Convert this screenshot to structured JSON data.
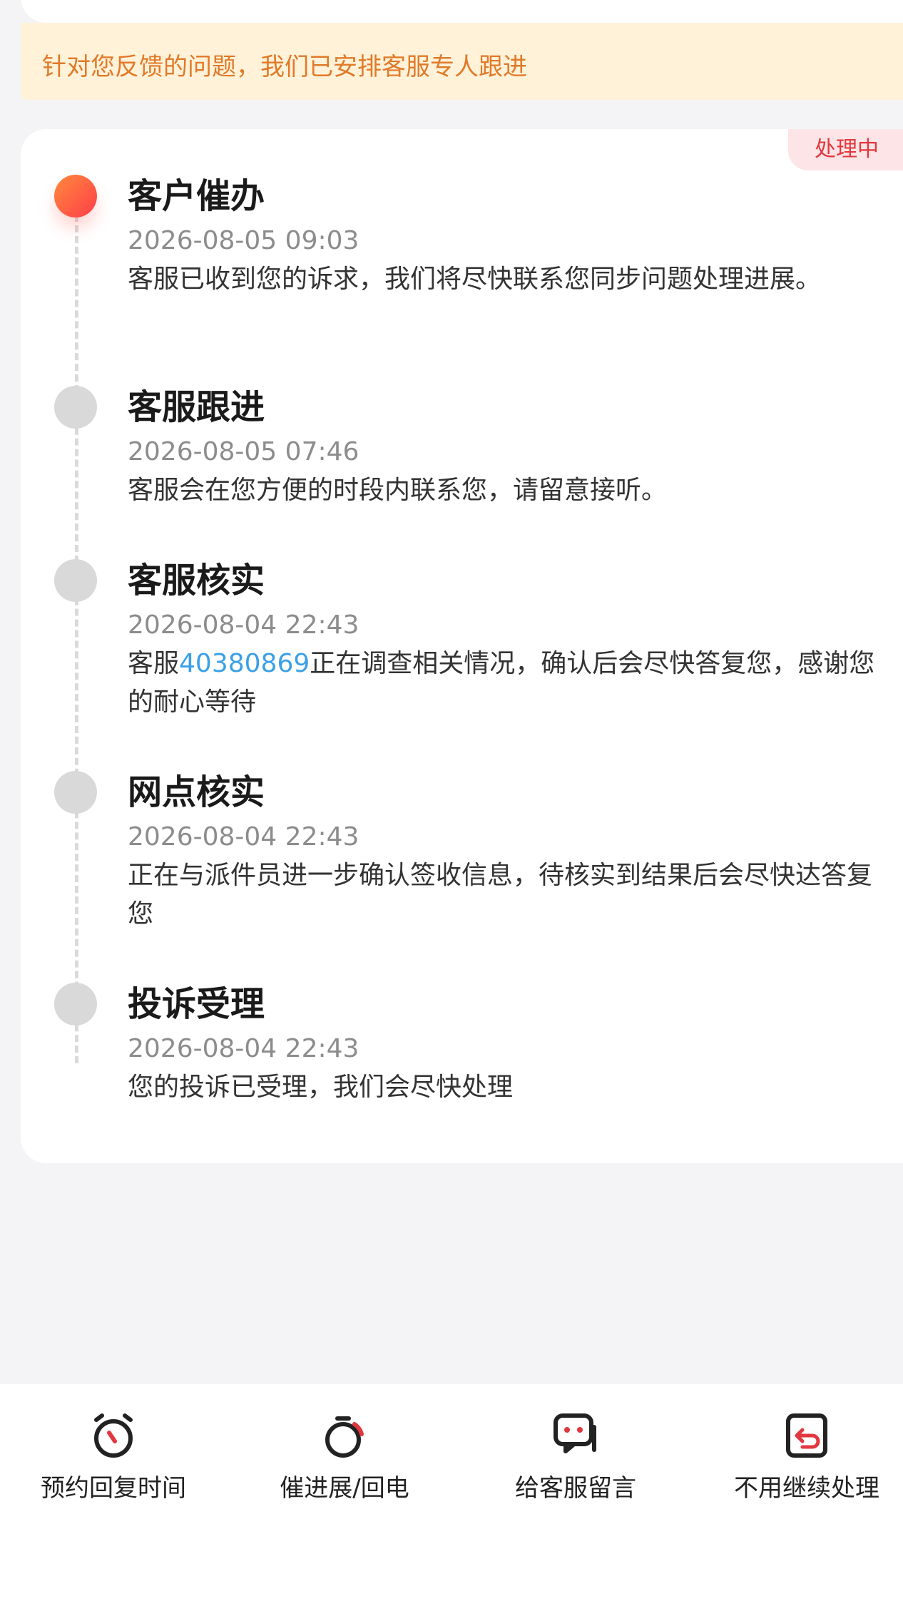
{
  "notice": {
    "text": "针对您反馈的问题，我们已安排客服专人跟进"
  },
  "status_badge": "处理中",
  "steps": [
    {
      "title": "客户催办",
      "time": "2026-08-05 09:03",
      "desc": "客服已收到您的诉求，我们将尽快联系您同步问题处理进展。",
      "active": true
    },
    {
      "title": "客服跟进",
      "time": "2026-08-05 07:46",
      "desc": "客服会在您方便的时段内联系您，请留意接听。",
      "active": false
    },
    {
      "title": "客服核实",
      "time": "2026-08-04 22:43",
      "desc_prefix": "客服",
      "desc_link": "40380869",
      "desc_suffix": "正在调查相关情况，确认后会尽快答复您，感谢您的耐心等待",
      "active": false
    },
    {
      "title": "网点核实",
      "time": "2026-08-04 22:43",
      "desc": "正在与派件员进一步确认签收信息，待核实到结果后会尽快达答复您",
      "active": false
    },
    {
      "title": "投诉受理",
      "time": "2026-08-04 22:43",
      "desc": "您的投诉已受理，我们会尽快处理",
      "active": false
    }
  ],
  "actions": [
    {
      "label": "预约回复时间",
      "icon": "alarm-clock-icon"
    },
    {
      "label": "催进展/回电",
      "icon": "stopwatch-icon"
    },
    {
      "label": "给客服留言",
      "icon": "chat-bubble-icon"
    },
    {
      "label": "不用继续处理",
      "icon": "return-box-icon"
    }
  ],
  "colors": {
    "accent": "#e2373f",
    "notice_text": "#e07a2a",
    "link": "#3ba0e6"
  }
}
